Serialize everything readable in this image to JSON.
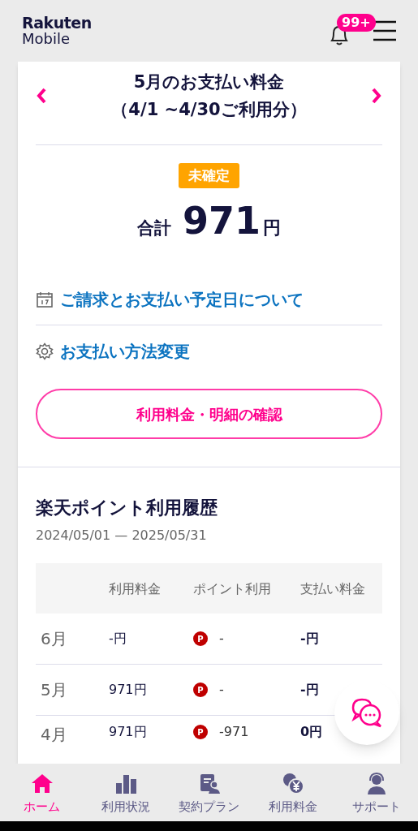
{
  "header": {
    "logo": [
      "Rakuten",
      "Mobile"
    ],
    "notification_badge": "99+"
  },
  "billing": {
    "title": [
      "5月のお支払い料金",
      "（4/1 ~4/30ご利用分）"
    ],
    "status_badge": "未確定",
    "total_label": "合計",
    "total_amount": "971",
    "total_unit": "円",
    "links": [
      {
        "kind": "calendar",
        "label": "ご請求とお支払い予定日について"
      },
      {
        "kind": "gear",
        "label": "お支払い方法変更"
      }
    ],
    "button": "利用料金・明細の確認"
  },
  "points": {
    "title": "楽天ポイント利用履歴",
    "period": "2024/05/01 — 2025/05/31",
    "table": {
      "columns": [
        "利用料金",
        "ポイント利用",
        "支払い料金"
      ],
      "rows": [
        {
          "month": "6月",
          "usage": "-円",
          "point_icon": "P",
          "points": "-",
          "payment": "-円"
        },
        {
          "month": "5月",
          "usage": "971円",
          "point_icon": "P",
          "points": "-",
          "payment": "-円"
        },
        {
          "month": "4月",
          "usage": "971円",
          "point_icon": "P",
          "points": "-971",
          "payment": "0円"
        }
      ]
    }
  },
  "bottom_nav": [
    {
      "kind": "home",
      "label": "ホーム",
      "selected": true
    },
    {
      "kind": "chart",
      "label": "利用状況",
      "selected": false
    },
    {
      "kind": "contract",
      "label": "契約プラン",
      "selected": false
    },
    {
      "kind": "coins",
      "label": "利用料金",
      "selected": false
    },
    {
      "kind": "support",
      "label": "サポート",
      "selected": false
    }
  ]
}
